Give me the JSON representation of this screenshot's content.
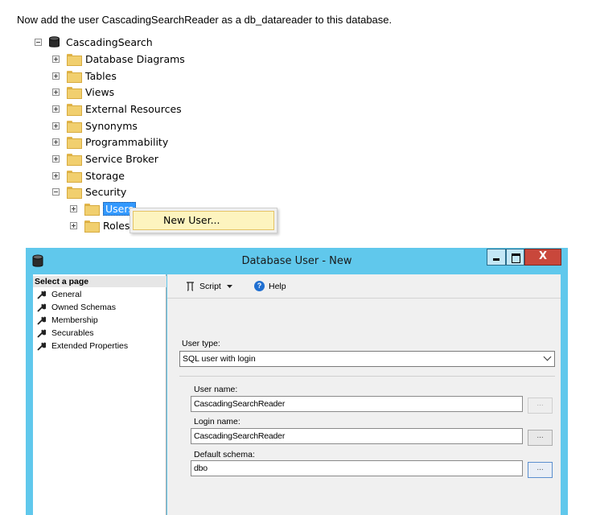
{
  "instruction": "Now add the user CascadingSearchReader as a db_datareader to this database.",
  "tree": {
    "root": {
      "label": "CascadingSearch",
      "icon": "database-icon"
    },
    "folders": [
      {
        "label": "Database Diagrams"
      },
      {
        "label": "Tables"
      },
      {
        "label": "Views"
      },
      {
        "label": "External Resources"
      },
      {
        "label": "Synonyms"
      },
      {
        "label": "Programmability"
      },
      {
        "label": "Service Broker"
      },
      {
        "label": "Storage"
      },
      {
        "label": "Security"
      }
    ],
    "security_children": [
      {
        "label": "Users",
        "selected": true
      },
      {
        "label": "Roles"
      }
    ]
  },
  "context_menu": {
    "items": [
      "New User..."
    ]
  },
  "dialog": {
    "title": "Database User - New",
    "close_label": "X",
    "select_page_header": "Select a page",
    "pages": [
      "General",
      "Owned Schemas",
      "Membership",
      "Securables",
      "Extended Properties"
    ],
    "toolbar": {
      "script_label": "Script",
      "help_label": "Help"
    },
    "user_type_label": "User type:",
    "user_type_value": "SQL user with login",
    "user_name_label": "User name:",
    "user_name_value": "CascadingSearchReader",
    "login_name_label": "Login name:",
    "login_name_value": "CascadingSearchReader",
    "default_schema_label": "Default schema:",
    "default_schema_value": "dbo",
    "ellipsis_label": "..."
  },
  "colors": {
    "titlebar": "#60c8ec",
    "close_button": "#c9473b",
    "selection": "#3399ff",
    "menu_highlight": "#fdf4bf",
    "folder": "#f1cf6e"
  }
}
